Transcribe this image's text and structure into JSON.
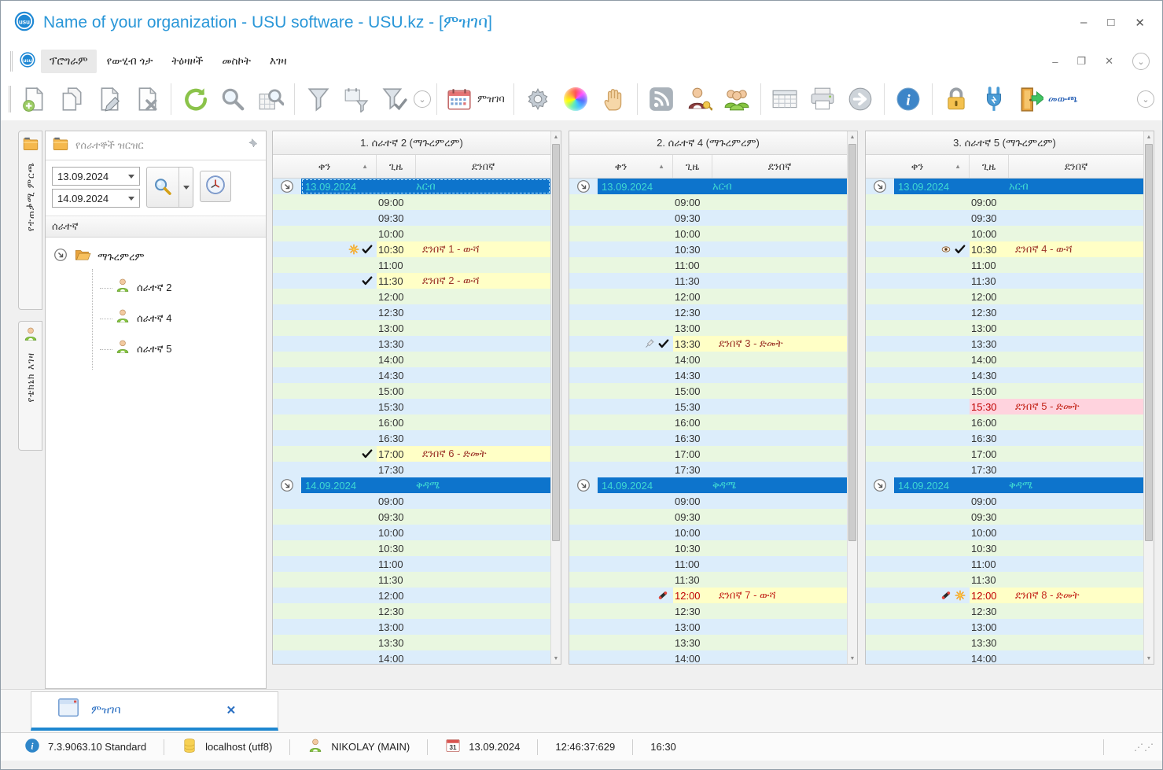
{
  "window": {
    "title": "Name of your organization - USU software - USU.kz - [ምዝገባ]",
    "controls": {
      "minimize": "–",
      "maximize": "□",
      "close": "✕"
    }
  },
  "menu": {
    "items": [
      "ፕሮግራም",
      "የውሂብ ጎታ",
      "ትዕዛዞች",
      "መስኮት",
      "እገዛ"
    ],
    "controls": {
      "minimize": "–",
      "restore": "❐",
      "close": "✕"
    }
  },
  "toolbar": {
    "items": [
      {
        "type": "button",
        "icon": "add-document"
      },
      {
        "type": "button",
        "icon": "copy-document"
      },
      {
        "type": "button",
        "icon": "edit-document"
      },
      {
        "type": "button",
        "icon": "delete-document"
      },
      {
        "type": "separator"
      },
      {
        "type": "button",
        "icon": "refresh"
      },
      {
        "type": "button",
        "icon": "search"
      },
      {
        "type": "button",
        "icon": "search-table"
      },
      {
        "type": "separator"
      },
      {
        "type": "button",
        "icon": "filter"
      },
      {
        "type": "button",
        "icon": "filter-window"
      },
      {
        "type": "button",
        "icon": "filter-check"
      },
      {
        "type": "chevron"
      },
      {
        "type": "separator"
      },
      {
        "type": "button",
        "icon": "calendar",
        "label": "ምዝገባ"
      },
      {
        "type": "separator"
      },
      {
        "type": "button",
        "icon": "gear"
      },
      {
        "type": "button",
        "icon": "color-wheel"
      },
      {
        "type": "button",
        "icon": "hand"
      },
      {
        "type": "separator"
      },
      {
        "type": "button",
        "icon": "rss"
      },
      {
        "type": "button",
        "icon": "user-key"
      },
      {
        "type": "button",
        "icon": "users-group"
      },
      {
        "type": "separator"
      },
      {
        "type": "button",
        "icon": "table"
      },
      {
        "type": "button",
        "icon": "print"
      },
      {
        "type": "button",
        "icon": "export-arrow"
      },
      {
        "type": "separator"
      },
      {
        "type": "button",
        "icon": "info"
      },
      {
        "type": "separator"
      },
      {
        "type": "button",
        "icon": "lock"
      },
      {
        "type": "button",
        "icon": "plug"
      },
      {
        "type": "button",
        "icon": "exit-door",
        "label": "መውጫ",
        "label_blue": true
      }
    ]
  },
  "sidebar": {
    "tabs": [
      {
        "icon": "folder",
        "label": "የተጠቃሚ ምርጫ"
      },
      {
        "icon": "person",
        "label": "የቴክኒክ እገዛ"
      }
    ],
    "panel_title": "የሰራተኞች ዝርዝር",
    "date_from": "13.09.2024",
    "date_to": "14.09.2024",
    "tree_header": "ሰራተኛ",
    "group_label": "ማጉረምረም",
    "employees": [
      "ሰራተኛ 2",
      "ሰራተኛ 4",
      "ሰራተኛ 5"
    ]
  },
  "calendar": {
    "subheaders": {
      "day": "ቀን",
      "time": "ጊዜ",
      "client": "ደንበኛ"
    },
    "sections": [
      {
        "date": "13.09.2024",
        "weekday": "አርብ",
        "times": [
          "09:00",
          "09:30",
          "10:00",
          "10:30",
          "11:00",
          "11:30",
          "12:00",
          "12:30",
          "13:00",
          "13:30",
          "14:00",
          "14:30",
          "15:00",
          "15:30",
          "16:00",
          "16:30",
          "17:00",
          "17:30"
        ]
      },
      {
        "date": "14.09.2024",
        "weekday": "ቅዳሜ",
        "times": [
          "09:00",
          "09:30",
          "10:00",
          "10:30",
          "11:00",
          "11:30",
          "12:00",
          "12:30",
          "13:00",
          "13:30",
          "14:00"
        ]
      }
    ],
    "columns": [
      {
        "title": "1. ሰራተኛ 2 (ማጉረምረም)",
        "focused": true,
        "appointments": [
          {
            "section": 0,
            "time": "10:30",
            "client": "ደንበኛ 1 - ውሻ",
            "icons": [
              "star",
              "check"
            ],
            "confirmed": true,
            "color": "yellow"
          },
          {
            "section": 0,
            "time": "11:30",
            "client": "ደንበኛ 2 - ውሻ",
            "icons": [
              "check"
            ],
            "confirmed": true,
            "color": "yellow"
          },
          {
            "section": 0,
            "time": "17:00",
            "client": "ደንበኛ 6 - ድመት",
            "icons": [
              "check"
            ],
            "confirmed": true,
            "color": "yellow"
          }
        ]
      },
      {
        "title": "2. ሰራተኛ 4 (ማጉረምረም)",
        "focused": false,
        "appointments": [
          {
            "section": 0,
            "time": "13:30",
            "client": "ደንበኛ 3 - ድመት",
            "icons": [
              "syringe",
              "check"
            ],
            "confirmed": true,
            "color": "yellow"
          },
          {
            "section": 1,
            "time": "12:00",
            "client": "ደንበኛ 7 - ውሻ",
            "icons": [
              "phone"
            ],
            "confirmed": false,
            "color": "yellow"
          }
        ]
      },
      {
        "title": "3. ሰራተኛ 5 (ማጉረምረም)",
        "focused": false,
        "appointments": [
          {
            "section": 0,
            "time": "10:30",
            "client": "ደንበኛ 4 - ውሻ",
            "icons": [
              "eye",
              "check"
            ],
            "confirmed": true,
            "color": "yellow"
          },
          {
            "section": 0,
            "time": "15:30",
            "client": "ደንበኛ 5 - ድመት",
            "icons": [],
            "confirmed": false,
            "color": "pink"
          },
          {
            "section": 1,
            "time": "12:00",
            "client": "ደንበኛ 8 - ድመት",
            "icons": [
              "phone",
              "star"
            ],
            "confirmed": false,
            "color": "yellow"
          }
        ]
      }
    ]
  },
  "tabbar": {
    "tab_label": "ምዝገባ",
    "close": "✕"
  },
  "statusbar": {
    "version": "7.3.9063.10 Standard",
    "database": "localhost (utf8)",
    "user": "NIKOLAY (MAIN)",
    "calendar_day": "31",
    "date": "13.09.2024",
    "time_ms": "12:46:37:629",
    "time_extra": "16:30"
  }
}
